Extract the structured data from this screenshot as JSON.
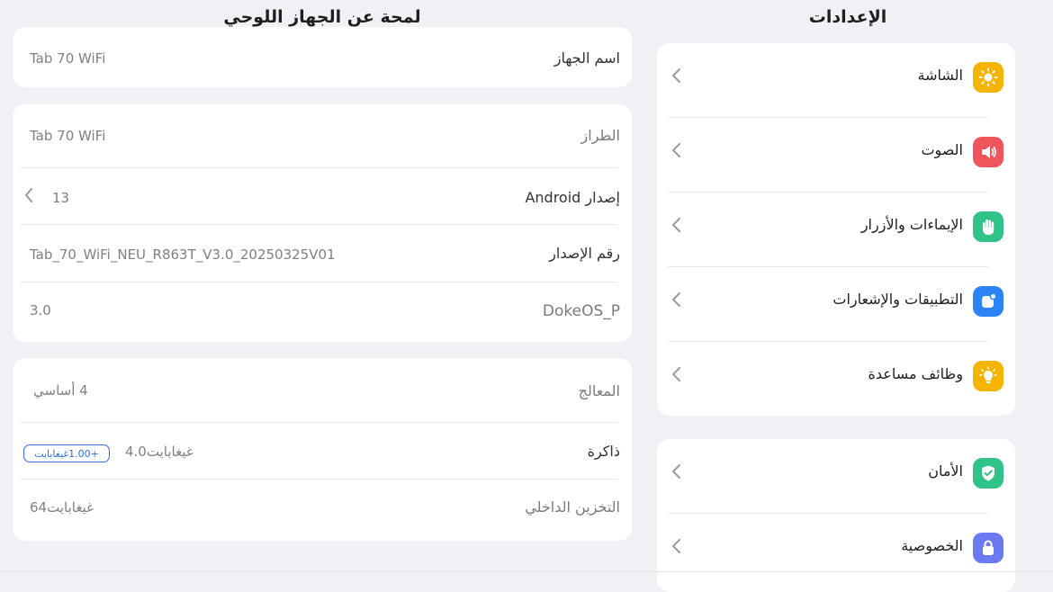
{
  "settings": {
    "title": "الإعدادات",
    "groups": [
      {
        "items": [
          {
            "label": "الشاشة",
            "icon": "sun-icon",
            "color": "#f5b400"
          },
          {
            "label": "الصوت",
            "icon": "speaker-icon",
            "color": "#f0555c"
          },
          {
            "label": "الإيماءات والأزرار",
            "icon": "hand-icon",
            "color": "#2fc38a"
          },
          {
            "label": "التطبيقات والإشعارات",
            "icon": "app-notification-icon",
            "color": "#2b84f5"
          },
          {
            "label": "وظائف مساعدة",
            "icon": "lightbulb-icon",
            "color": "#f5b400"
          }
        ]
      },
      {
        "items": [
          {
            "label": "الأمان",
            "icon": "shield-check-icon",
            "color": "#2fc38a"
          },
          {
            "label": "الخصوصية",
            "icon": "lock-icon",
            "color": "#6b79f2"
          }
        ]
      }
    ]
  },
  "about": {
    "title": "لمحة عن الجهاز اللوحي",
    "device_name": {
      "label": "اسم الجهاز",
      "value": "Tab 70 WiFi"
    },
    "model": {
      "label": "الطراز",
      "value": "Tab 70 WiFi"
    },
    "android": {
      "label": "إصدار Android",
      "value": "13"
    },
    "build": {
      "label": "رقم الإصدار",
      "value": "Tab_70_WiFi_NEU_R863T_V3.0_20250325V01"
    },
    "os": {
      "label": "DokeOS_P",
      "value": "3.0"
    },
    "processor": {
      "label": "المعالج",
      "value": "4 أساسي"
    },
    "memory": {
      "label": "ذاكرة",
      "value": "4.0غيغابايت",
      "extra": "+1.00غيغابايت"
    },
    "storage": {
      "label": "التخزين الداخلي",
      "value": "64غيغابايت"
    }
  }
}
